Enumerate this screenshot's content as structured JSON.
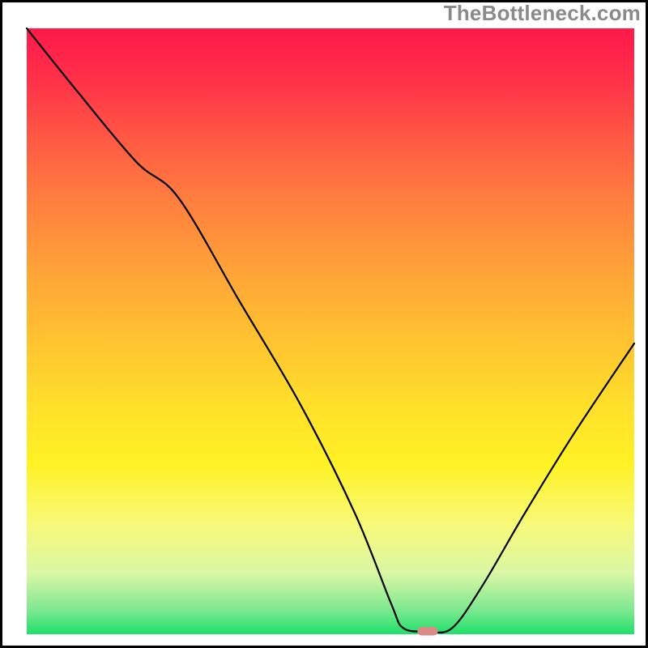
{
  "watermark": "TheBottleneck.com",
  "chart_data": {
    "type": "line",
    "title": "",
    "xlabel": "",
    "ylabel": "",
    "xlim": [
      0,
      100
    ],
    "ylim": [
      0,
      100
    ],
    "series": [
      {
        "name": "bottleneck-curve",
        "x": [
          0,
          8,
          18,
          25,
          35,
          45,
          54,
          60,
          62,
          66,
          70,
          75,
          82,
          90,
          100
        ],
        "y": [
          100,
          90,
          78,
          72,
          55,
          38,
          20,
          5,
          1,
          0.5,
          1,
          8,
          20,
          33,
          48
        ]
      }
    ],
    "marker": {
      "x": 66,
      "y": 0.5,
      "label": "optimal-point"
    },
    "gradient_bands": [
      {
        "position": 0,
        "meaning": "worst",
        "color": "#ff194a"
      },
      {
        "position": 50,
        "meaning": "mid",
        "color": "#ffc430"
      },
      {
        "position": 85,
        "meaning": "good",
        "color": "#f7f97a"
      },
      {
        "position": 100,
        "meaning": "best",
        "color": "#1fe06a"
      }
    ]
  }
}
